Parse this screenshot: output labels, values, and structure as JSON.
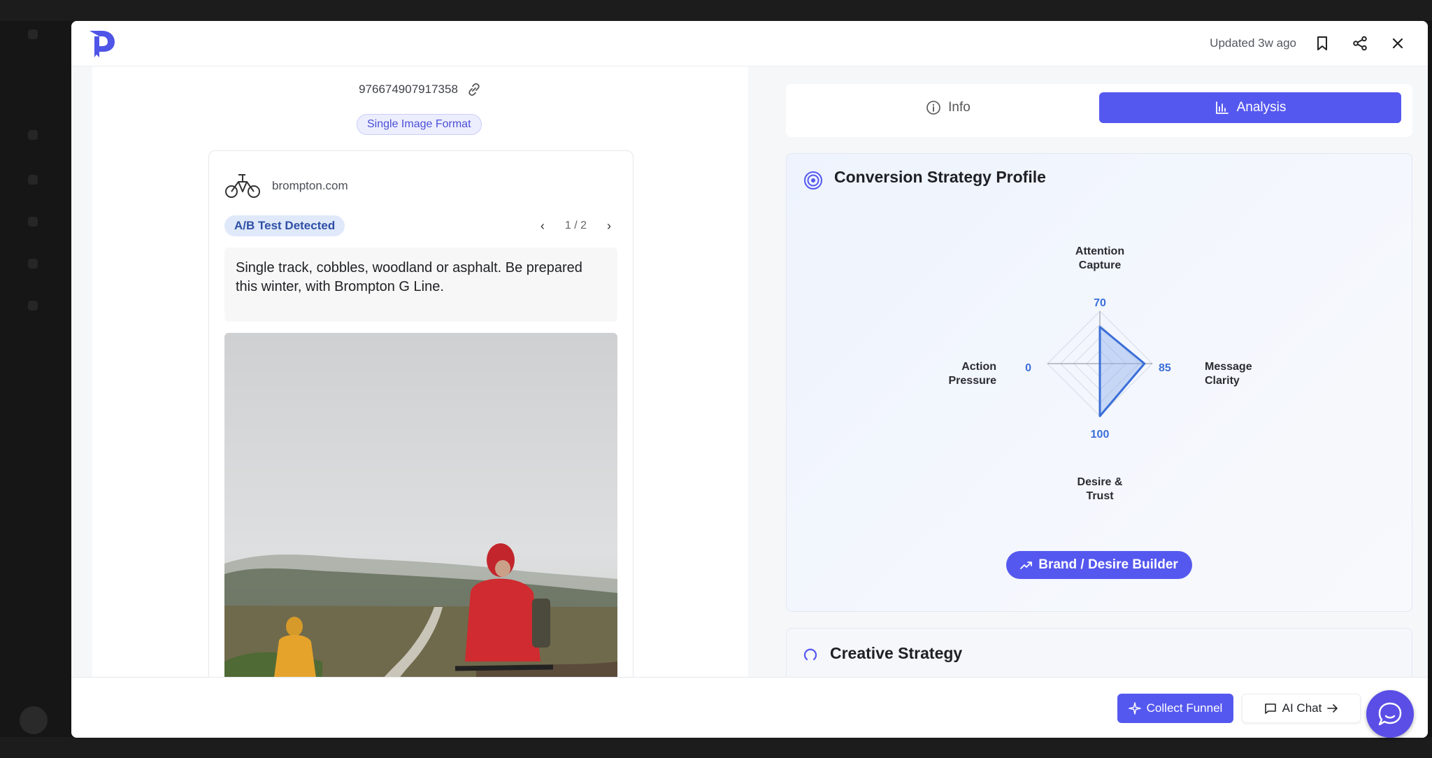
{
  "header": {
    "updated": "Updated 3w ago",
    "icons": [
      "bookmark-icon",
      "share-icon",
      "close-icon"
    ]
  },
  "ad": {
    "id": "976674907917358",
    "format": "Single Image Format",
    "brand": "brompton.com",
    "ab_badge": "A/B Test Detected",
    "pager": "1 / 2",
    "text": "Single track, cobbles, woodland or asphalt. Be prepared this winter, with Brompton G Line."
  },
  "tabs": {
    "info": "Info",
    "analysis": "Analysis",
    "active": "analysis"
  },
  "profile": {
    "title": "Conversion Strategy Profile",
    "builder": "Brand / Desire Builder"
  },
  "chart_data": {
    "type": "radar",
    "axes": [
      "Attention Capture",
      "Message Clarity",
      "Desire & Trust",
      "Action Pressure"
    ],
    "values": [
      70,
      85,
      100,
      0
    ],
    "max": 100,
    "colors": {
      "fill": "#8fb0ee",
      "stroke": "#3b6fd8",
      "label": "#3b6fd8"
    }
  },
  "creative": {
    "title": "Creative Strategy"
  },
  "footer": {
    "collect": "Collect Funnel",
    "chat": "AI Chat"
  },
  "colors": {
    "accent": "#5558ef",
    "ab_badge_bg": "#e0e9fa"
  }
}
